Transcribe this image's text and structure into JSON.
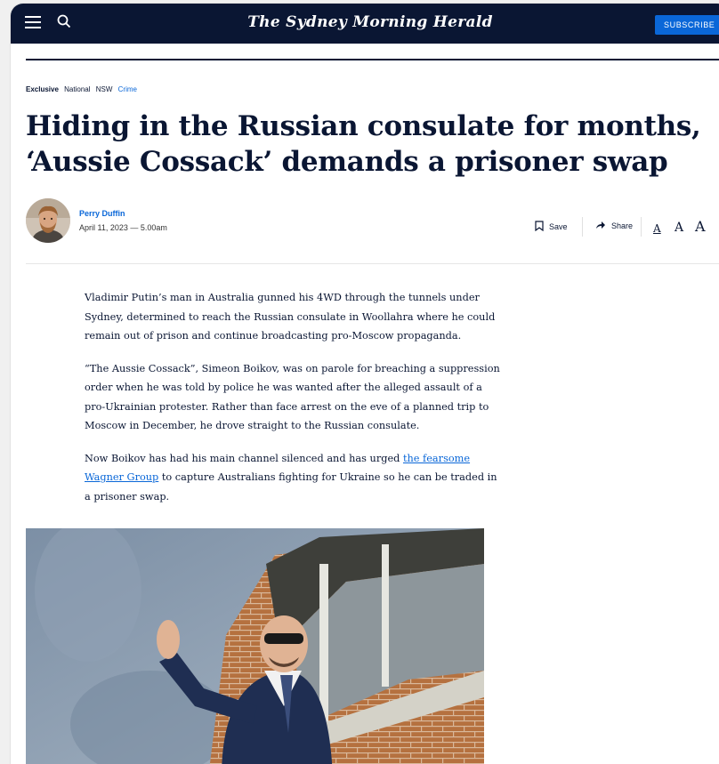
{
  "header": {
    "masthead": "The Sydney Morning Herald",
    "subscribe_label": "SUBSCRIBE"
  },
  "tags": {
    "exclusive": "Exclusive",
    "national": "National",
    "nsw": "NSW",
    "crime": "Crime"
  },
  "headline": "Hiding in the Russian consulate for months, ‘Aussie Cossack’ demands a prisoner swap",
  "byline": {
    "author": "Perry Duffin",
    "date": "April 11, 2023 — 5.00am"
  },
  "tools": {
    "save_label": "Save",
    "share_label": "Share",
    "font_small": "A",
    "font_medium": "A",
    "font_large": "A"
  },
  "article": {
    "p1": "Vladimir Putin’s man in Australia gunned his 4WD through the tunnels under Sydney, determined to reach the Russian consulate in Woollahra where he could remain out of prison and continue broadcasting pro-Moscow propaganda.",
    "p2": "“The Aussie Cossack”, Simeon Boikov, was on parole for breaching a suppression order when he was told by police he was wanted after the alleged assault of a pro-Ukrainian protester. Rather than face arrest on the eve of a planned trip to Moscow in December, he drove straight to the Russian consulate.",
    "p3_before": "Now Boikov has had his main channel silenced and has urged ",
    "p3_link": "the fearsome Wagner Group",
    "p3_after": " to capture Australians fighting for Ukraine so he can be traded in a prisoner swap."
  },
  "colors": {
    "navy": "#0a1633",
    "accent_blue": "#0a67d8"
  },
  "icons": [
    "menu-icon",
    "search-icon",
    "bookmark-icon",
    "share-arrow-icon"
  ]
}
